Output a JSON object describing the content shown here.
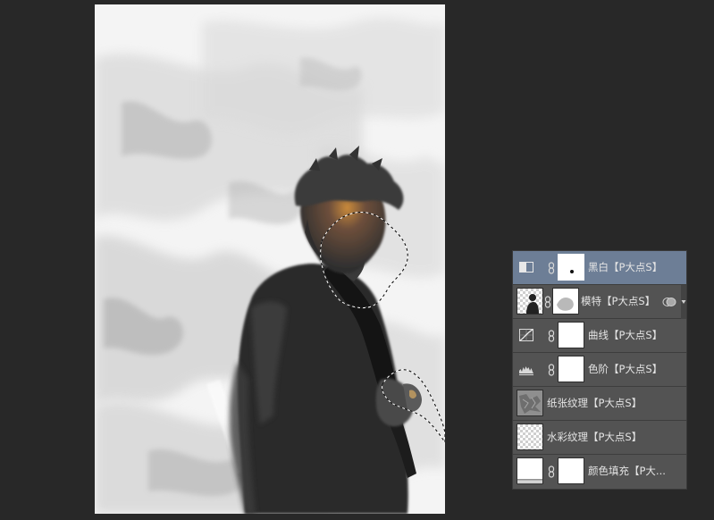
{
  "layers_panel": {
    "layers": [
      {
        "name": "黑白【P大点S】",
        "type": "adjustment",
        "icon": "black-white-adjustment-icon",
        "has_mask": true,
        "linked": true,
        "selected": true
      },
      {
        "name": "模特【P大点S】",
        "type": "pixel",
        "icon": "model-photo-thumbnail",
        "has_mask": true,
        "linked": true,
        "selected": false,
        "has_effects": true
      },
      {
        "name": "曲线【P大点S】",
        "type": "adjustment",
        "icon": "curves-adjustment-icon",
        "has_mask": true,
        "linked": true,
        "selected": false
      },
      {
        "name": "色阶【P大点S】",
        "type": "adjustment",
        "icon": "levels-adjustment-icon",
        "has_mask": true,
        "linked": true,
        "selected": false
      },
      {
        "name": "纸张纹理【P大点S】",
        "type": "pixel",
        "icon": "paper-texture-thumbnail",
        "has_mask": false,
        "selected": false
      },
      {
        "name": "水彩纹理【P大点S】",
        "type": "pixel",
        "icon": "watercolor-texture-thumbnail",
        "has_mask": false,
        "selected": false
      },
      {
        "name": "颜色填充【P大...",
        "type": "fill",
        "icon": "color-fill-thumbnail",
        "has_mask": true,
        "linked": true,
        "selected": false
      }
    ]
  },
  "colors": {
    "app_background": "#282828",
    "panel_background": "#535353",
    "selected_row": "#6d7e96",
    "canvas_paper": "#f6f6f6"
  }
}
